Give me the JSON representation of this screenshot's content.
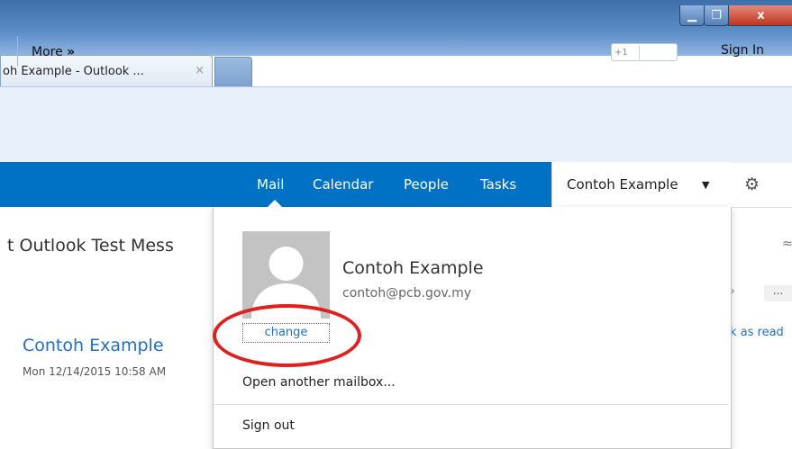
{
  "browser": {
    "tab_title": "oh Example - Outlook ...",
    "tab_close_glyph": "×",
    "min_glyph": "▁",
    "max_glyph": "❐",
    "close_glyph": "x",
    "home_glyph": "⌂",
    "star_glyph": "★"
  },
  "toolbar": {
    "more_label": "More",
    "more_glyph": "»",
    "gplus_label": "+1",
    "sign_in_label": "Sign In"
  },
  "nav": {
    "mail": "Mail",
    "calendar": "Calendar",
    "people": "People",
    "tasks": "Tasks",
    "account_name": "Contoh Example",
    "account_caret": "▼",
    "settings_glyph": "⚙"
  },
  "message": {
    "subject": "t Outlook Test Mess",
    "sender": "Contoh Example",
    "date": "Mon 12/14/2015 10:58 AM",
    "mark_read_label": "k as read",
    "dots_label": "...",
    "collapse_glyph": "≈",
    "chevron_glyph": "›"
  },
  "account_panel": {
    "name": "Contoh Example",
    "email": "contoh@pcb.gov.my",
    "change_label": "change",
    "open_mailbox_label": "Open another mailbox...",
    "sign_out_label": "Sign out"
  },
  "colors": {
    "owa_blue": "#0072c6",
    "link_blue": "#1f70c4",
    "highlight_red": "#e21f1f"
  }
}
